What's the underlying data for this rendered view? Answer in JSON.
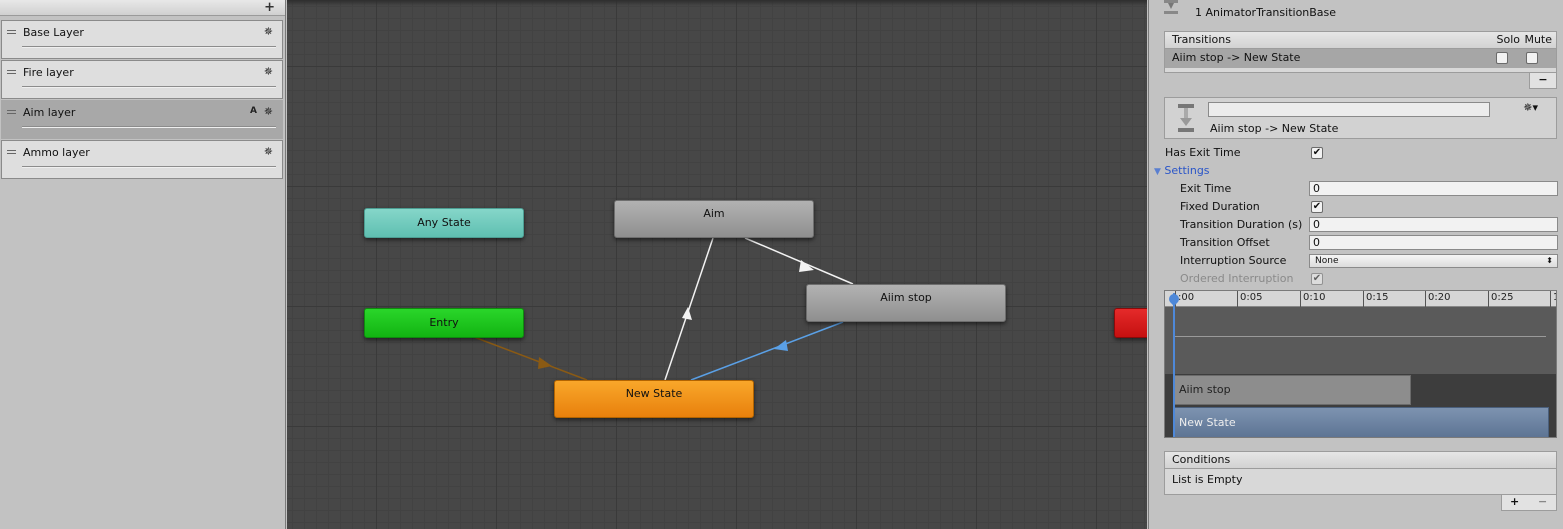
{
  "layers": {
    "add_label": "+",
    "items": [
      {
        "name": "Base Layer",
        "gear": "✵",
        "badge": ""
      },
      {
        "name": "Fire layer",
        "gear": "✵",
        "badge": ""
      },
      {
        "name": "Aim layer",
        "gear": "✵",
        "badge": "A"
      },
      {
        "name": "Ammo layer",
        "gear": "✵",
        "badge": ""
      }
    ]
  },
  "graph": {
    "nodes": {
      "any_state": "Any State",
      "entry": "Entry",
      "aim": "Aim",
      "aiim_stop": "Aiim stop",
      "new_state": "New State"
    },
    "colors": {
      "any_state": "#6ecabd",
      "entry": "#1ec81e",
      "default_state": "#f29216",
      "exit": "#d81c1c",
      "selected_transition": "#5aa0e6",
      "entry_transition": "#8a5a14"
    }
  },
  "inspector": {
    "header_title": "1 AnimatorTransitionBase",
    "transitions": {
      "header": "Transitions",
      "solo_label": "Solo",
      "mute_label": "Mute",
      "row": "Aiim stop -> New State",
      "remove_label": "−"
    },
    "transition_name_value": "",
    "transition_subtitle": "Aiim stop -> New State",
    "has_exit_time_label": "Has Exit Time",
    "has_exit_time": true,
    "settings_label": "Settings",
    "exit_time_label": "Exit Time",
    "exit_time_value": "0",
    "fixed_duration_label": "Fixed Duration",
    "fixed_duration": true,
    "transition_duration_label": "Transition Duration (s)",
    "transition_duration_value": "0",
    "transition_offset_label": "Transition Offset",
    "transition_offset_value": "0",
    "interruption_source_label": "Interruption Source",
    "interruption_source_value": "None",
    "ordered_interruption_label": "Ordered Interruption",
    "ordered_interruption": true,
    "timeline": {
      "ticks": [
        ":00",
        "0:05",
        "0:10",
        "0:15",
        "0:20",
        "0:25",
        "1"
      ],
      "bar_source": "Aiim stop",
      "bar_dest": "New State"
    },
    "conditions": {
      "header": "Conditions",
      "empty_text": "List is Empty",
      "add_label": "+",
      "remove_label": "−"
    }
  }
}
